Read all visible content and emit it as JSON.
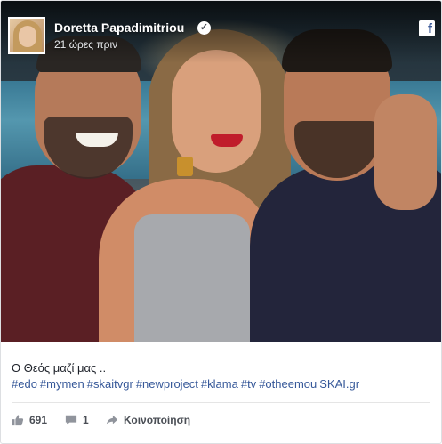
{
  "header": {
    "author_name": "Doretta Papadimitriou",
    "verified_icon": "check-badge-icon",
    "timestamp": "21 ώρες πριν",
    "brand_icon": "facebook-icon"
  },
  "post": {
    "photo_description_icon": "photo",
    "caption": "Ο Θεός μαζί μας ..",
    "hashtags": [
      "#edo",
      "#mymen",
      "#skaitvgr",
      "#newproject",
      "#klama",
      "#tv",
      "#otheemou",
      "SKAI.gr"
    ]
  },
  "actions": {
    "likes_count": "691",
    "comments_count": "1",
    "share_label": "Κοινοποίηση"
  },
  "colors": {
    "link": "#365899",
    "text": "#1d2129",
    "muted": "#616770",
    "facebook_blue": "#3b5998"
  }
}
